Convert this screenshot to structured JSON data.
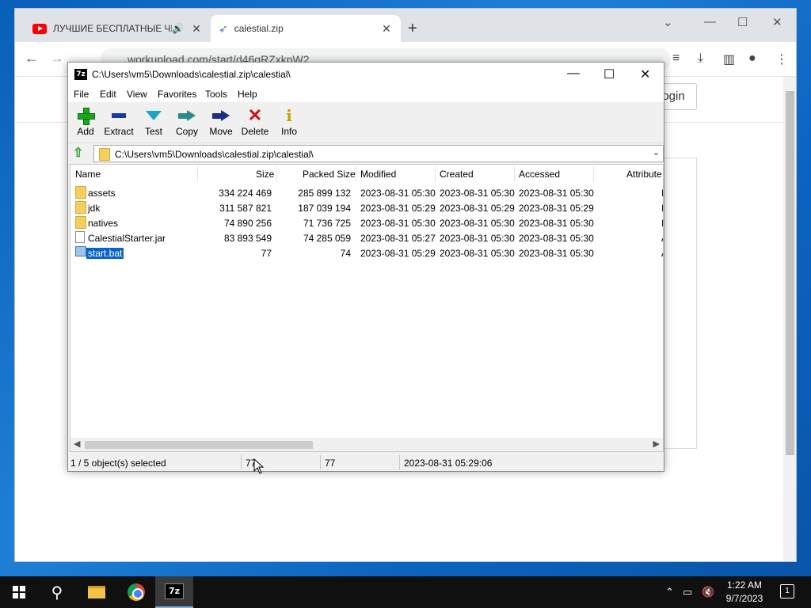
{
  "browser": {
    "tabs": [
      {
        "title": "ЛУЧШИЕ БЕСПЛАТНЫЕ ЧИТ",
        "icon": "youtube-icon",
        "audio": true
      },
      {
        "title": "calestial.zip",
        "icon": "rocket-icon"
      }
    ],
    "new_tab": "+",
    "url": "workupload.com/start/d46gRZxkpW2",
    "login_label": "login"
  },
  "sevenzip": {
    "title": "C:\\Users\\vm5\\Downloads\\calestial.zip\\calestial\\",
    "menu": [
      "File",
      "Edit",
      "View",
      "Favorites",
      "Tools",
      "Help"
    ],
    "toolbar": [
      {
        "label": "Add",
        "icon": "add-icon"
      },
      {
        "label": "Extract",
        "icon": "extract-icon"
      },
      {
        "label": "Test",
        "icon": "test-icon"
      },
      {
        "label": "Copy",
        "icon": "copy-icon"
      },
      {
        "label": "Move",
        "icon": "move-icon"
      },
      {
        "label": "Delete",
        "icon": "delete-icon"
      },
      {
        "label": "Info",
        "icon": "info-icon"
      }
    ],
    "address": "C:\\Users\\vm5\\Downloads\\calestial.zip\\calestial\\",
    "columns": [
      "Name",
      "Size",
      "Packed Size",
      "Modified",
      "Created",
      "Accessed",
      "Attribute"
    ],
    "files": [
      {
        "name": "assets",
        "type": "folder",
        "size": "334 224 469",
        "packed": "285 899 132",
        "modified": "2023-08-31 05:30",
        "created": "2023-08-31 05:30",
        "accessed": "2023-08-31 05:30",
        "attr": "I"
      },
      {
        "name": "jdk",
        "type": "folder",
        "size": "311 587 821",
        "packed": "187 039 194",
        "modified": "2023-08-31 05:29",
        "created": "2023-08-31 05:29",
        "accessed": "2023-08-31 05:29",
        "attr": "I"
      },
      {
        "name": "natives",
        "type": "folder",
        "size": "74 890 256",
        "packed": "71 736 725",
        "modified": "2023-08-31 05:30",
        "created": "2023-08-31 05:30",
        "accessed": "2023-08-31 05:30",
        "attr": "I"
      },
      {
        "name": "CalestialStarter.jar",
        "type": "file",
        "size": "83 893 549",
        "packed": "74 285 059",
        "modified": "2023-08-31 05:27",
        "created": "2023-08-31 05:30",
        "accessed": "2023-08-31 05:30",
        "attr": "A"
      },
      {
        "name": "start.bat",
        "type": "bat",
        "size": "77",
        "packed": "74",
        "modified": "2023-08-31 05:29",
        "created": "2023-08-31 05:30",
        "accessed": "2023-08-31 05:30",
        "attr": "A",
        "selected": true
      }
    ],
    "status": {
      "selection": "1 / 5 object(s) selected",
      "size": "77",
      "packed": "77",
      "date": "2023-08-31 05:29:06"
    }
  },
  "taskbar": {
    "time": "1:22 AM",
    "date": "9/7/2023",
    "notifications": "1"
  }
}
